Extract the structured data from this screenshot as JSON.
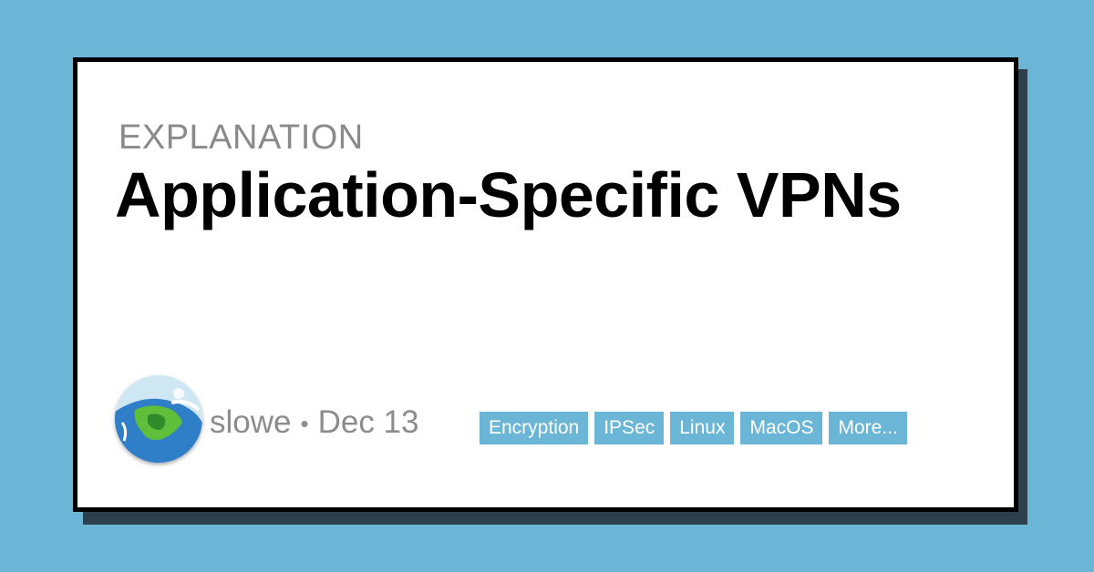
{
  "header": {
    "kicker": "EXPLANATION",
    "title": "Application-Specific VPNs"
  },
  "author": {
    "name": "slowe",
    "separator": "•",
    "date": "Dec 13"
  },
  "tags": [
    "Encryption",
    "IPSec",
    "Linux",
    "MacOS",
    "More..."
  ],
  "colors": {
    "background": "#6bb6d6",
    "tag": "#6bb6d6",
    "shadow": "#2c3f4c"
  }
}
